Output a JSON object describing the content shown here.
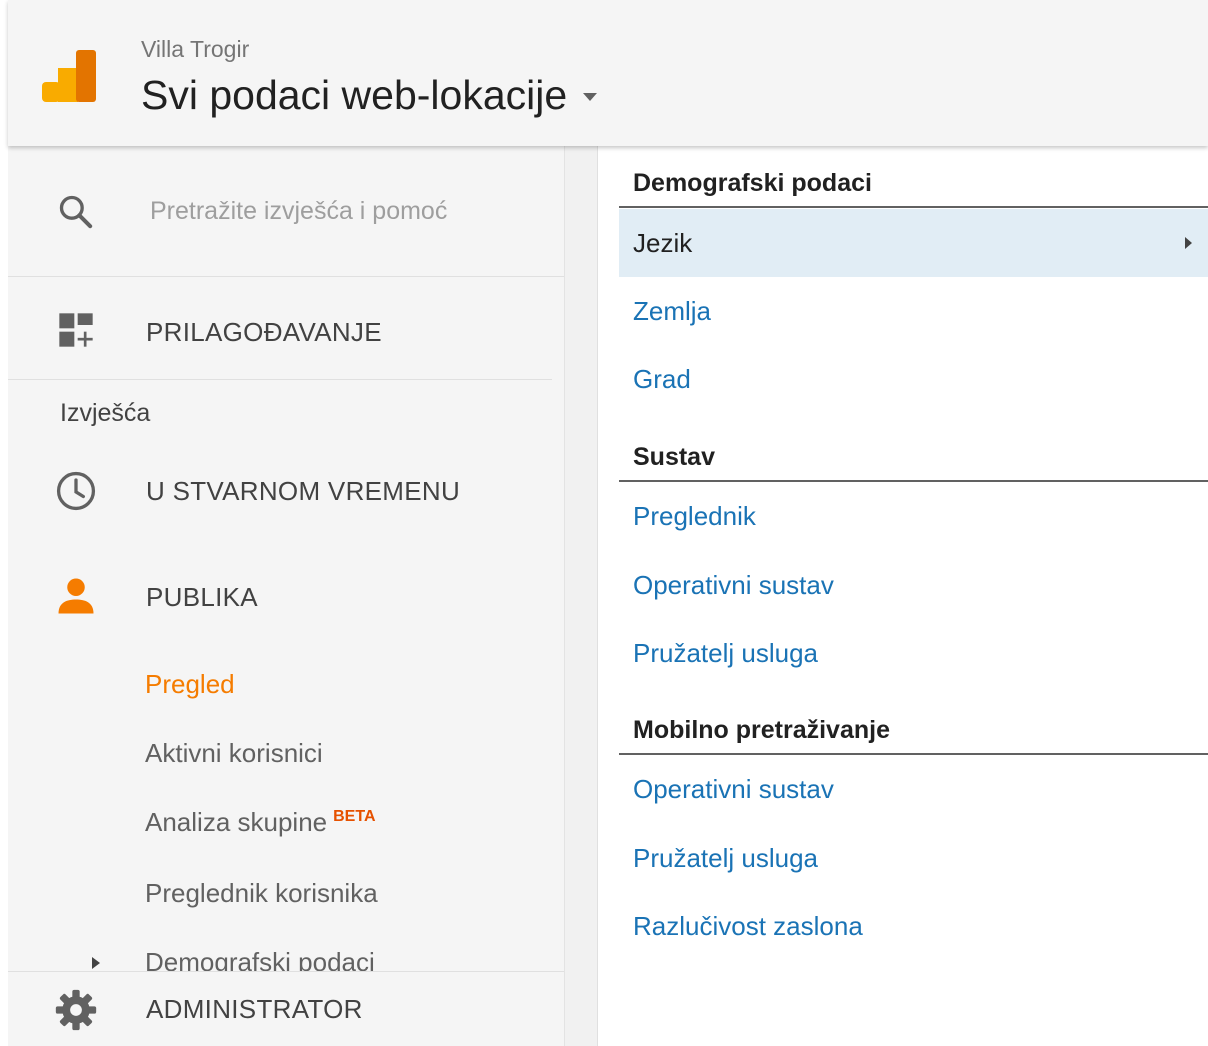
{
  "header": {
    "account_name": "Villa Trogir",
    "view_name": "Svi podaci web-lokacije",
    "logo_colors": [
      "#f9ab00",
      "#e37400"
    ]
  },
  "sidebar": {
    "search_placeholder": "Pretražite izvješća i pomoć",
    "customization_label": "PRILAGOĐAVANJE",
    "reports_heading": "Izvješća",
    "realtime_label": "U STVARNOM VREMENU",
    "audience_label": "PUBLIKA",
    "audience_items": [
      {
        "label": "Pregled",
        "active": true
      },
      {
        "label": "Aktivni korisnici",
        "active": false
      },
      {
        "label": "Analiza skupine",
        "badge": "BETA",
        "active": false
      },
      {
        "label": "Preglednik korisnika",
        "active": false
      },
      {
        "label": "Demografski podaci",
        "active": false
      }
    ],
    "admin_label": "ADMINISTRATOR",
    "accent_color": "#f57c00"
  },
  "panel": {
    "groups": [
      {
        "title": "Demografski podaci",
        "items": [
          "Jezik",
          "Zemlja",
          "Grad"
        ],
        "selected_index": 0
      },
      {
        "title": "Sustav",
        "items": [
          "Preglednik",
          "Operativni sustav",
          "Pružatelj usluga"
        ]
      },
      {
        "title": "Mobilno pretraživanje",
        "items": [
          "Operativni sustav",
          "Pružatelj usluga",
          "Razlučivost zaslona"
        ]
      }
    ],
    "link_color": "#1a73b5",
    "selected_bg": "#e1edf5"
  }
}
